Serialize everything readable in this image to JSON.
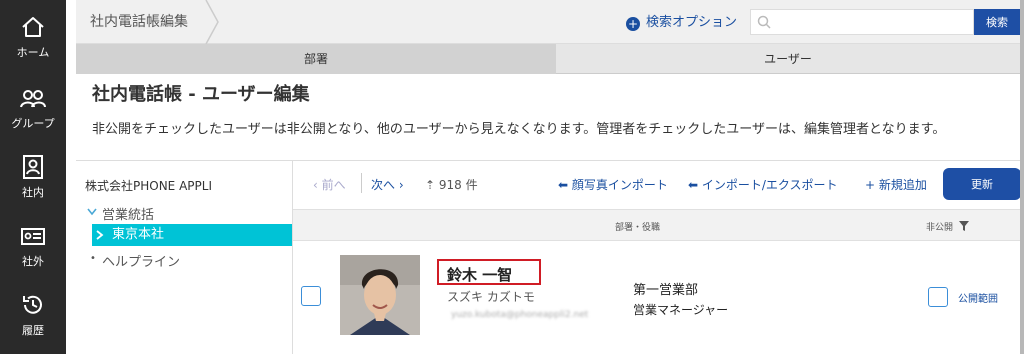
{
  "sidebar": {
    "items": [
      {
        "label": "ホーム",
        "icon": "home-icon"
      },
      {
        "label": "グループ",
        "icon": "group-icon"
      },
      {
        "label": "社内",
        "icon": "internal-contact-icon"
      },
      {
        "label": "社外",
        "icon": "external-contact-icon"
      },
      {
        "label": "履歴",
        "icon": "history-icon"
      }
    ]
  },
  "header": {
    "breadcrumb": "社内電話帳編集",
    "search_option": "検索オプション",
    "search_placeholder": "",
    "search_button": "検索"
  },
  "tabs": [
    {
      "label": "部署",
      "active": true
    },
    {
      "label": "ユーザー",
      "active": false
    }
  ],
  "page": {
    "title": "社内電話帳 - ユーザー編集",
    "description": "非公開をチェックしたユーザーは非公開となり、他のユーザーから見えなくなります。管理者をチェックしたユーザーは、編集管理者となります。"
  },
  "tree": {
    "root": "株式会社PHONE APPLI",
    "nodes": [
      {
        "label": "営業統括",
        "expanded": true
      },
      {
        "label": "東京本社",
        "selected": true
      },
      {
        "label": "ヘルプライン"
      }
    ]
  },
  "toolbar": {
    "prev": "前へ",
    "next": "次へ",
    "count": "918 件",
    "photo_import": "顔写真インポート",
    "import_export": "インポート/エクスポート",
    "add_new": "新規追加",
    "update": "更新"
  },
  "columns": {
    "dept_title": "部署・役職",
    "private": "非公開"
  },
  "user_row": {
    "name": "鈴木 一智",
    "kana": "スズキ カズトモ",
    "email": "yuzo.kubota@phoneappli2.net",
    "department": "第一営業部",
    "position": "営業マネージャー",
    "scope_link": "公開範囲"
  },
  "colors": {
    "sidebar_bg": "#2a2a2a",
    "accent_blue": "#1e4fa5",
    "tree_selected": "#00c3d6",
    "highlight_red": "#d01c25"
  }
}
